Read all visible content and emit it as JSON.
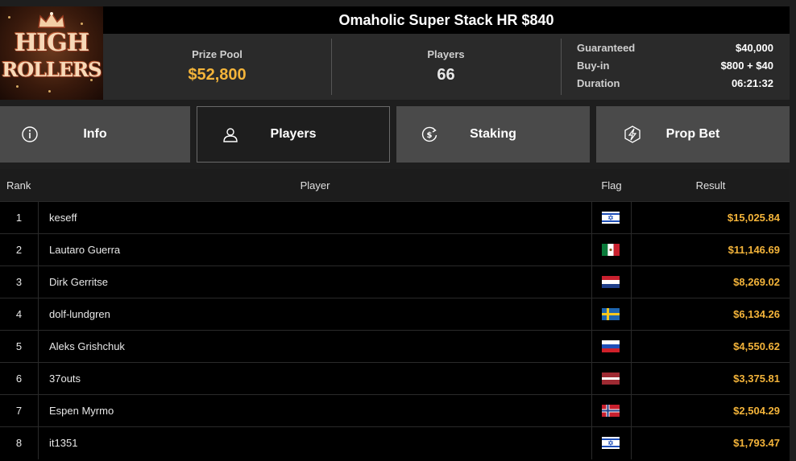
{
  "tournament": {
    "title": "Omaholic Super Stack HR $840",
    "logo": {
      "line1": "HIGH",
      "line2": "ROLLERS"
    }
  },
  "stats": {
    "prize_pool_label": "Prize Pool",
    "prize_pool_value": "$52,800",
    "players_label": "Players",
    "players_value": "66",
    "details": [
      {
        "label": "Guaranteed",
        "value": "$40,000"
      },
      {
        "label": "Buy-in",
        "value": "$800 + $40"
      },
      {
        "label": "Duration",
        "value": "06:21:32"
      }
    ]
  },
  "tabs": [
    {
      "label": "Info",
      "icon": "info-icon",
      "active": false
    },
    {
      "label": "Players",
      "icon": "user-icon",
      "active": true
    },
    {
      "label": "Staking",
      "icon": "dollar-refresh-icon",
      "active": false
    },
    {
      "label": "Prop Bet",
      "icon": "lightning-icon",
      "active": false
    }
  ],
  "table": {
    "columns": {
      "rank": "Rank",
      "player": "Player",
      "flag": "Flag",
      "result": "Result"
    },
    "rows": [
      {
        "rank": "1",
        "player": "keseff",
        "country": "israel",
        "result": "$15,025.84"
      },
      {
        "rank": "2",
        "player": "Lautaro Guerra",
        "country": "mexico",
        "result": "$11,146.69"
      },
      {
        "rank": "3",
        "player": "Dirk Gerritse",
        "country": "netherlands",
        "result": "$8,269.02"
      },
      {
        "rank": "4",
        "player": "dolf-lundgren",
        "country": "sweden",
        "result": "$6,134.26"
      },
      {
        "rank": "5",
        "player": "Aleks Grishchuk",
        "country": "russia",
        "result": "$4,550.62"
      },
      {
        "rank": "6",
        "player": "37outs",
        "country": "latvia",
        "result": "$3,375.81"
      },
      {
        "rank": "7",
        "player": "Espen Myrmo",
        "country": "norway",
        "result": "$2,504.29"
      },
      {
        "rank": "8",
        "player": "it1351",
        "country": "israel",
        "result": "$1,793.47"
      }
    ]
  },
  "colors": {
    "accent_gold": "#f4b43a",
    "background": "#1e1e1e",
    "tab_inactive": "#4a4a4a"
  }
}
